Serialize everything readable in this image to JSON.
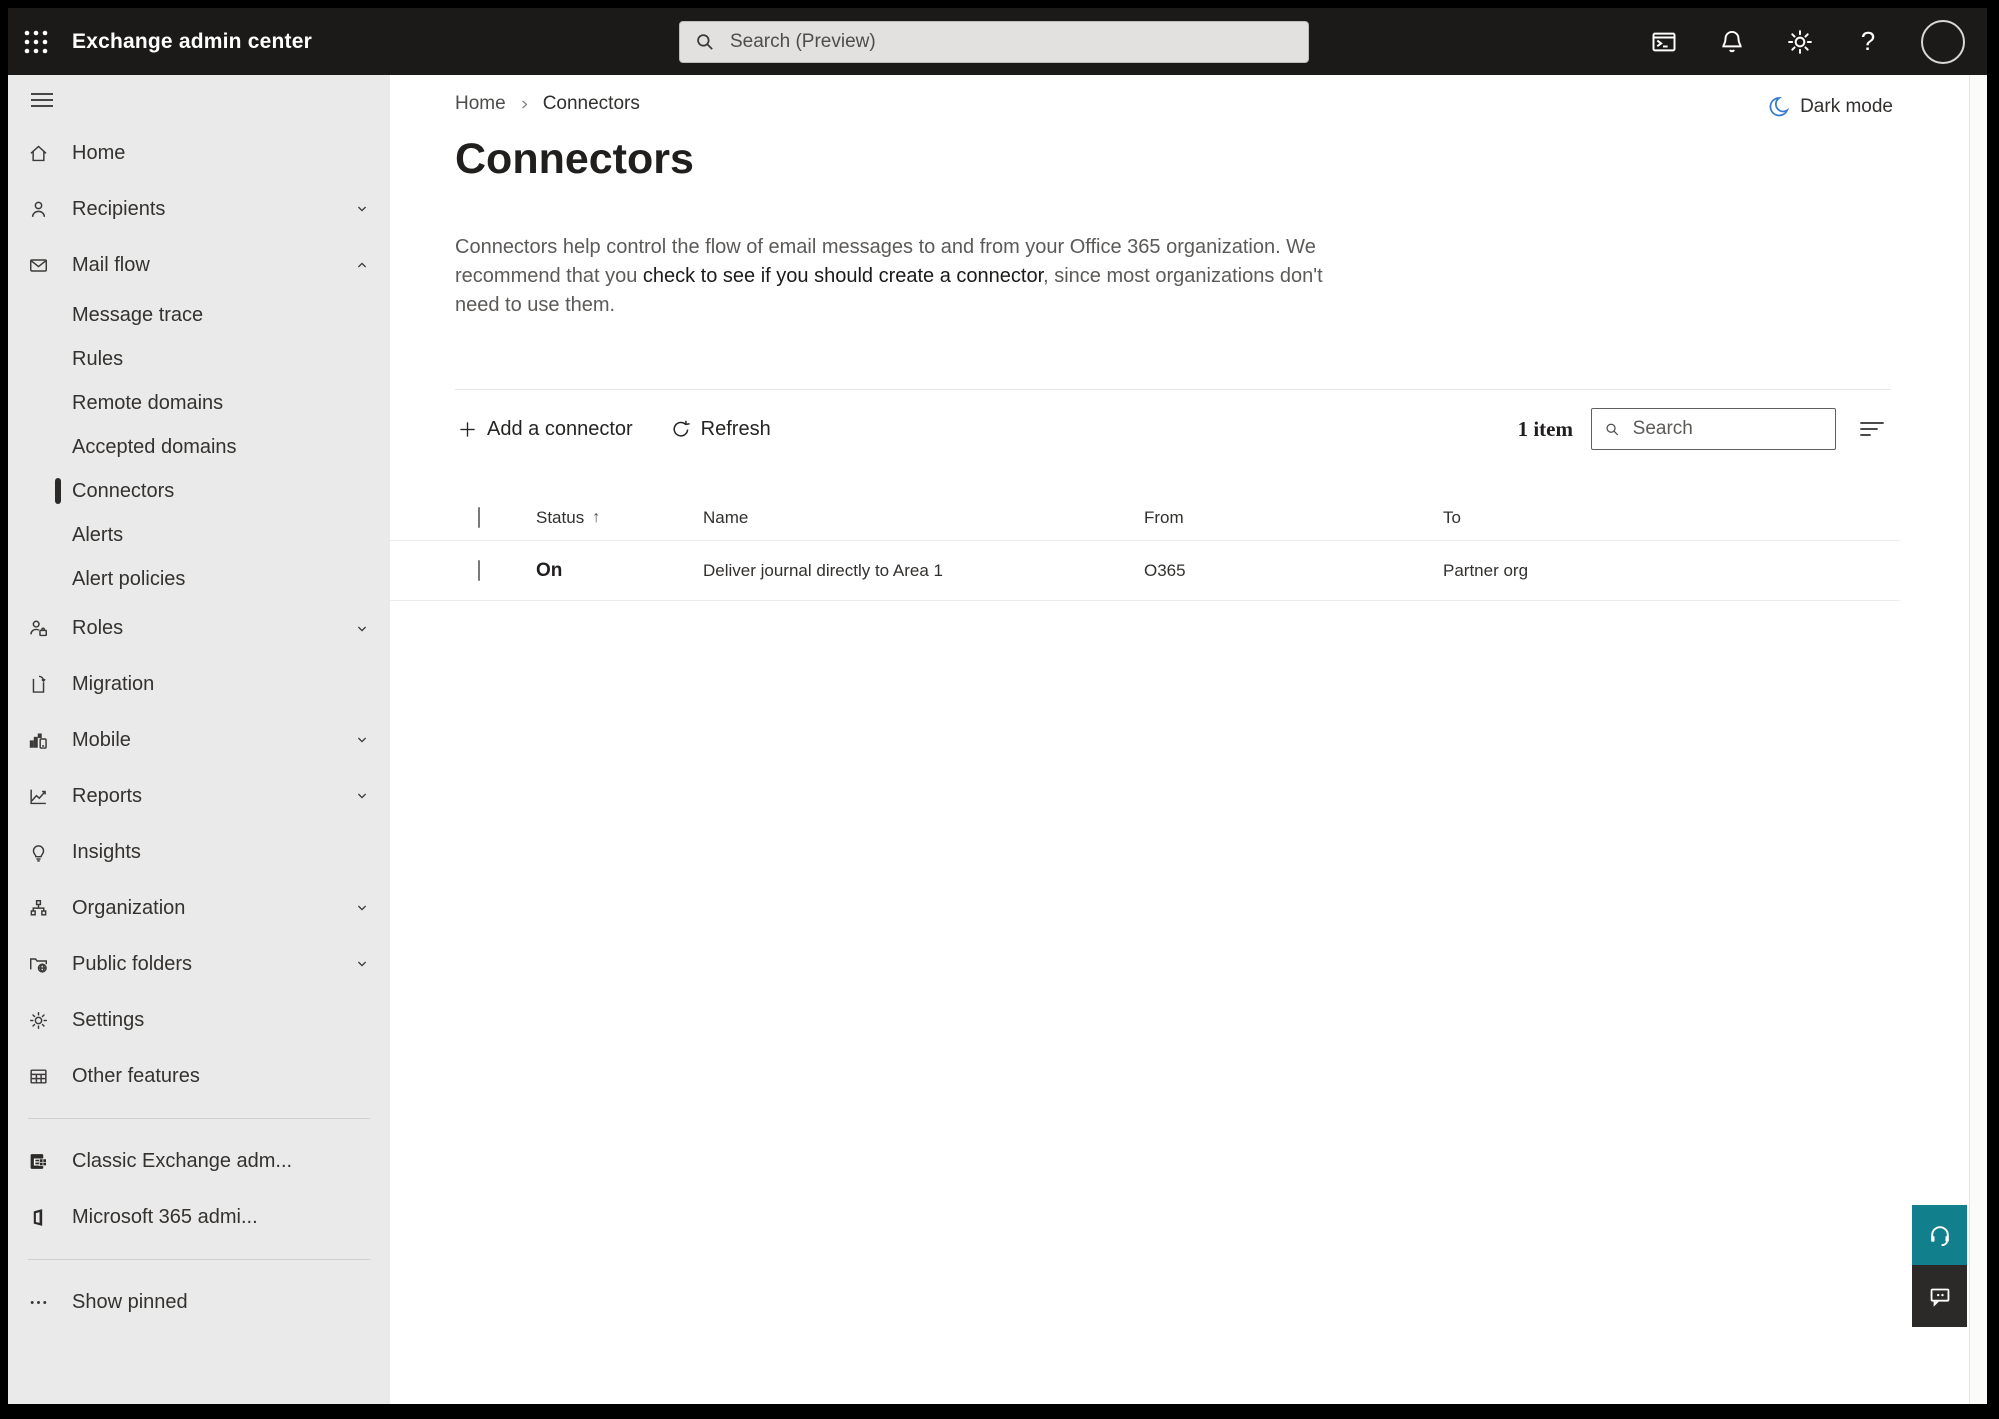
{
  "topbar": {
    "app_title": "Exchange admin center",
    "search_placeholder": "Search (Preview)",
    "help_glyph": "?"
  },
  "sidebar": {
    "items": [
      {
        "label": "Home"
      },
      {
        "label": "Recipients"
      },
      {
        "label": "Mail flow"
      },
      {
        "label": "Message trace"
      },
      {
        "label": "Rules"
      },
      {
        "label": "Remote domains"
      },
      {
        "label": "Accepted domains"
      },
      {
        "label": "Connectors"
      },
      {
        "label": "Alerts"
      },
      {
        "label": "Alert policies"
      },
      {
        "label": "Roles"
      },
      {
        "label": "Migration"
      },
      {
        "label": "Mobile"
      },
      {
        "label": "Reports"
      },
      {
        "label": "Insights"
      },
      {
        "label": "Organization"
      },
      {
        "label": "Public folders"
      },
      {
        "label": "Settings"
      },
      {
        "label": "Other features"
      },
      {
        "label": "Classic Exchange adm..."
      },
      {
        "label": "Microsoft 365 admi..."
      },
      {
        "label": "Show pinned"
      }
    ]
  },
  "breadcrumb": {
    "home": "Home",
    "current": "Connectors"
  },
  "header_actions": {
    "dark_mode_label": "Dark mode"
  },
  "page": {
    "title": "Connectors",
    "description_part1": "Connectors help control the flow of email messages to and from your Office 365 organization. We recommend that you ",
    "description_link": "check to see if you should create a connector",
    "description_part2": ", since most organizations don't need to use them."
  },
  "toolbar": {
    "add_connector_label": "Add a connector",
    "refresh_label": "Refresh",
    "item_count": "1 item",
    "search_placeholder": "Search"
  },
  "table": {
    "columns": {
      "status": "Status",
      "name": "Name",
      "from": "From",
      "to": "To"
    },
    "sort_icon": "↑",
    "rows": [
      {
        "status": "On",
        "name": "Deliver journal directly to Area 1",
        "from": "O365",
        "to": "Partner org"
      }
    ]
  },
  "colors": {
    "topbar_bg": "#1b1a19",
    "sidebar_bg": "#ebeaea",
    "accent_blue": "#337ad0",
    "support_teal": "#12808c"
  }
}
